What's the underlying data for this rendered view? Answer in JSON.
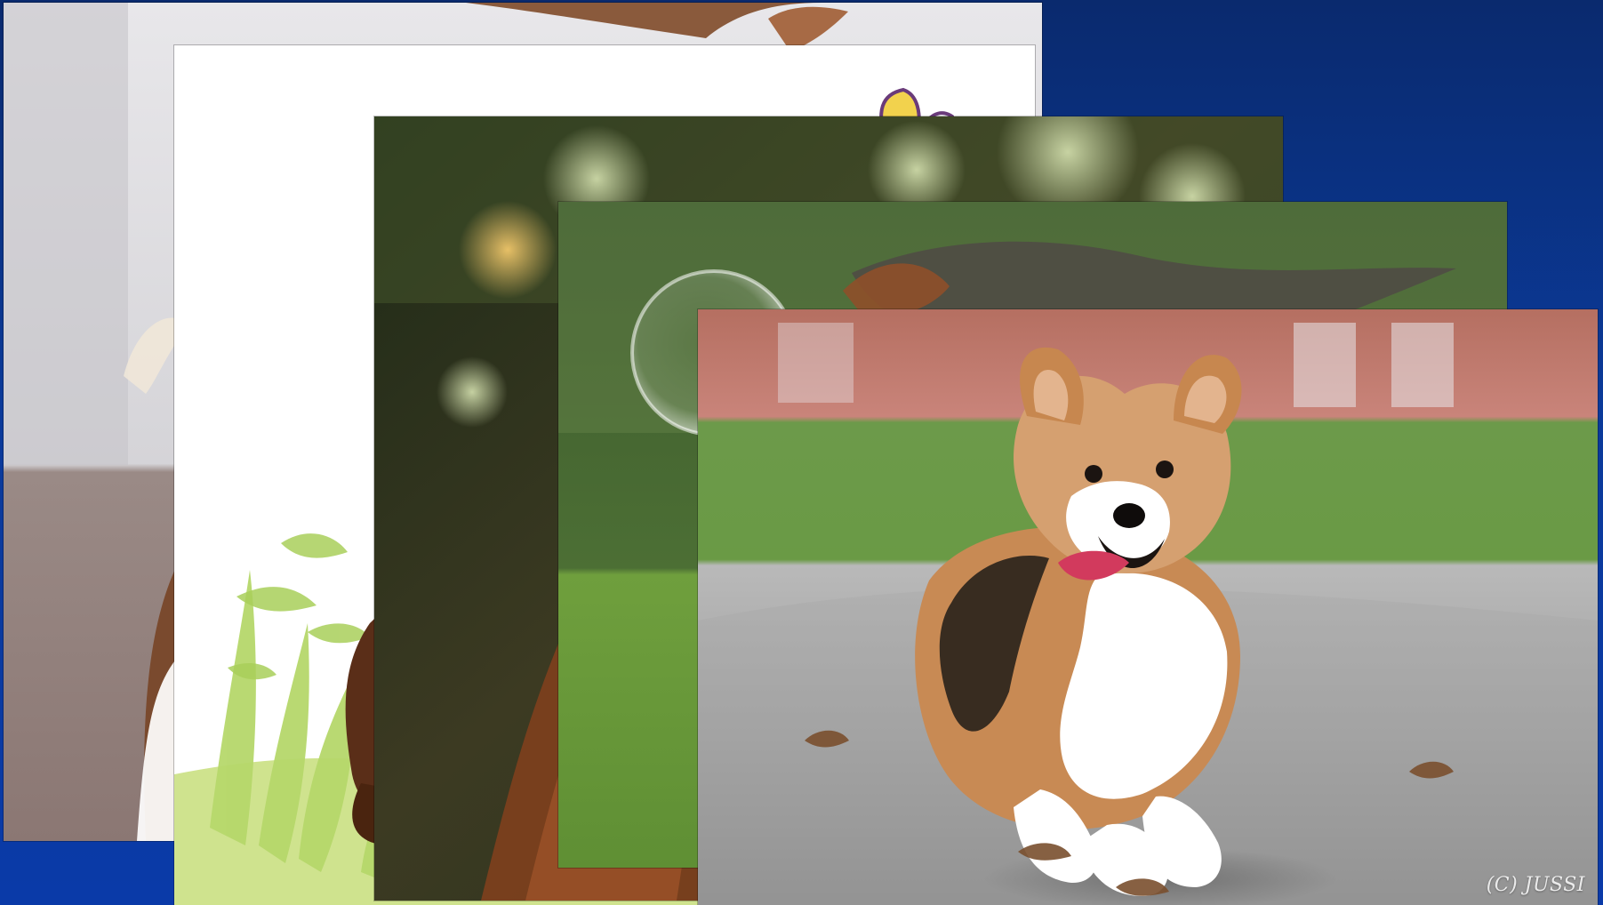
{
  "scene": {
    "background_color": "#0b3a9a"
  },
  "photos": [
    {
      "subject": "dog-on-white-background"
    },
    {
      "subject": "cartoon-dog-with-green-grass"
    },
    {
      "subject": "brown-dog-closeup-bokeh"
    },
    {
      "subject": "dog-with-bubbles-and-grass"
    },
    {
      "subject": "corgi-running",
      "watermark": "(C) JUSSI"
    }
  ]
}
